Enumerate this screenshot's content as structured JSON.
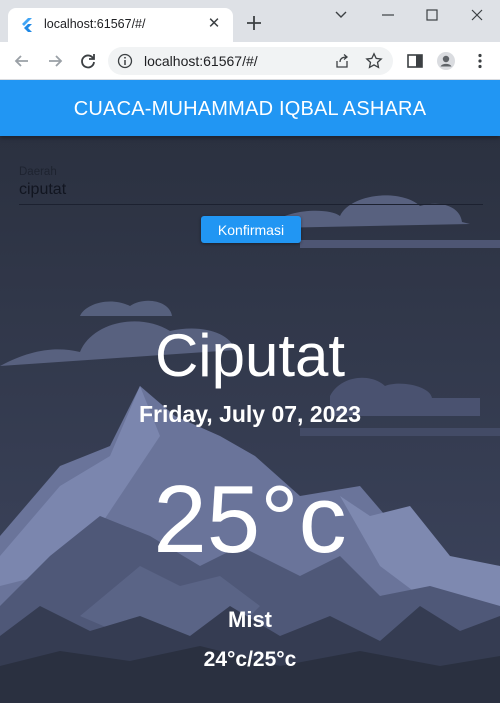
{
  "browser": {
    "tab_title": "localhost:61567/#/",
    "url": "localhost:61567/#/"
  },
  "app": {
    "title": "CUACA-MUHAMMAD IQBAL ASHARA",
    "region_label": "Daerah",
    "region_value": "ciputat",
    "confirm_label": "Konfirmasi"
  },
  "weather": {
    "city": "Ciputat",
    "date": "Friday, July 07, 2023",
    "temperature": "25°c",
    "condition": "Mist",
    "range": "24°c/25°c"
  },
  "colors": {
    "appbar": "#2196f3",
    "button": "#2196f3",
    "background_dark": "#272d3b"
  }
}
